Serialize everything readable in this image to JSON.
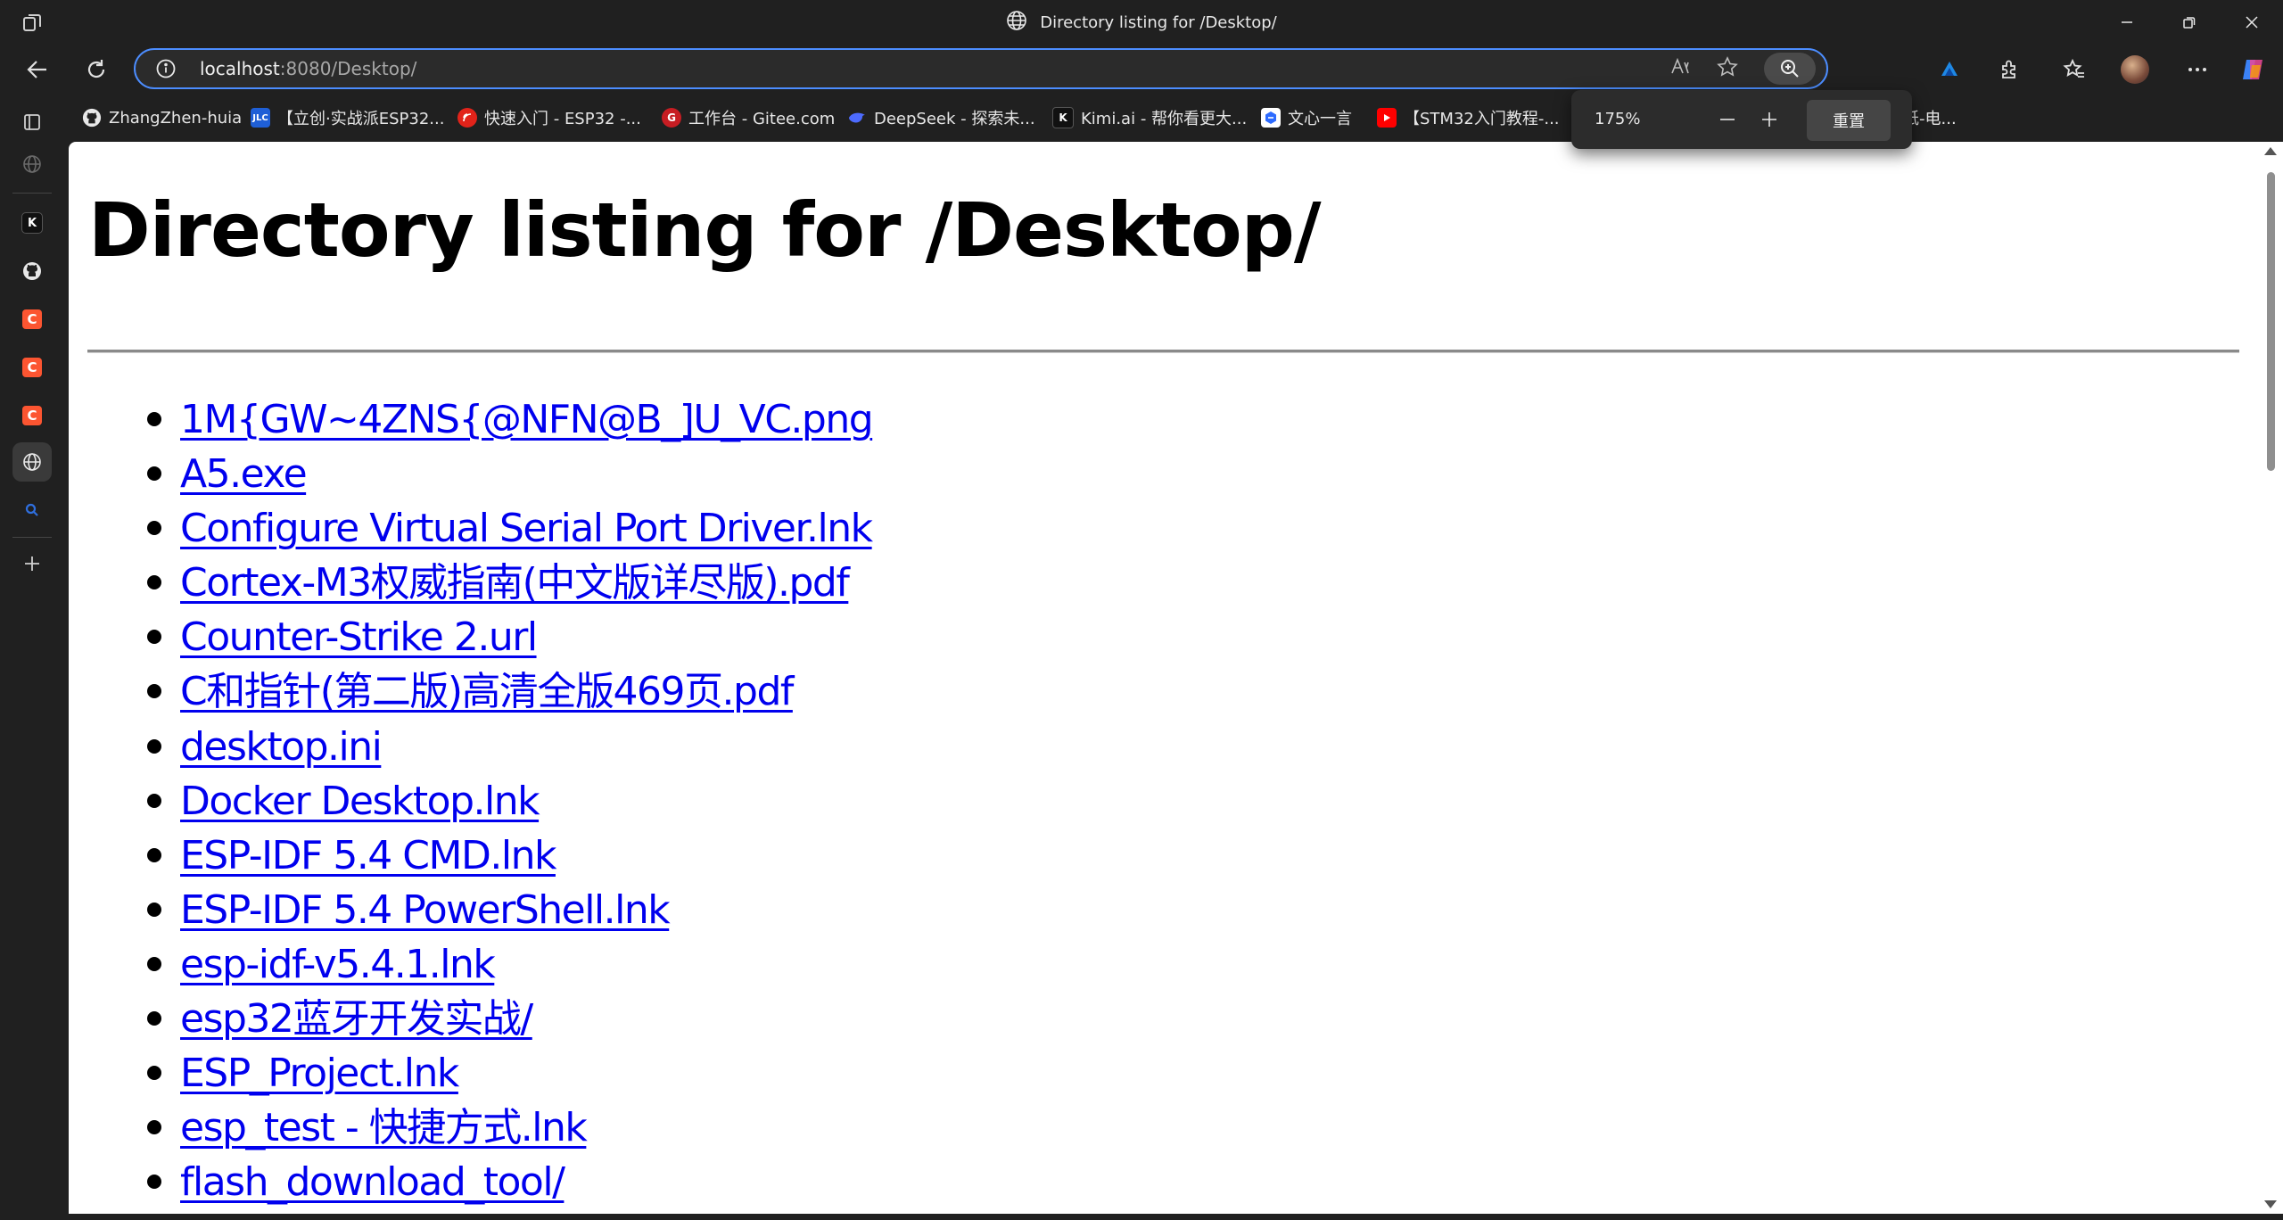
{
  "window": {
    "title": "Directory listing for /Desktop/"
  },
  "address": {
    "host": "localhost",
    "rest": ":8080/Desktop/"
  },
  "bookmarks": [
    {
      "label": "ZhangZhen-huia",
      "icon": "github-icon"
    },
    {
      "label": "【立创·实战派ESP32...",
      "icon": "jlc-icon"
    },
    {
      "label": "快速入门 - ESP32 -...",
      "icon": "espressif-icon"
    },
    {
      "label": "工作台 - Gitee.com",
      "icon": "gitee-icon"
    },
    {
      "label": "DeepSeek - 探索未...",
      "icon": "deepseek-icon"
    },
    {
      "label": "Kimi.ai - 帮你看更大...",
      "icon": "kimi-icon"
    },
    {
      "label": "文心一言",
      "icon": "wenxin-icon"
    },
    {
      "label": "【STM32入门教程-...",
      "icon": "youtube-icon"
    },
    {
      "label": "纸-电...",
      "icon": ""
    }
  ],
  "zoom": {
    "level": "175%",
    "reset_label": "重置"
  },
  "page": {
    "heading": "Directory listing for /Desktop/",
    "files": [
      "1M{GW~4ZNS{@NFN@B_]U_VC.png",
      "A5.exe",
      "Configure Virtual Serial Port Driver.lnk",
      "Cortex-M3权威指南(中文版详尽版).pdf",
      "Counter-Strike 2.url",
      "C和指针(第二版)高清全版469页.pdf",
      "desktop.ini",
      "Docker Desktop.lnk",
      "ESP-IDF 5.4 CMD.lnk",
      "ESP-IDF 5.4 PowerShell.lnk",
      "esp-idf-v5.4.1.lnk",
      "esp32蓝牙开发实战/",
      "ESP_Project.lnk",
      "esp_test - 快捷方式.lnk",
      "flash_download_tool/"
    ]
  },
  "colors": {
    "link": "#0000ee",
    "accent": "#4c8dff",
    "chrome_bg": "#202020"
  }
}
